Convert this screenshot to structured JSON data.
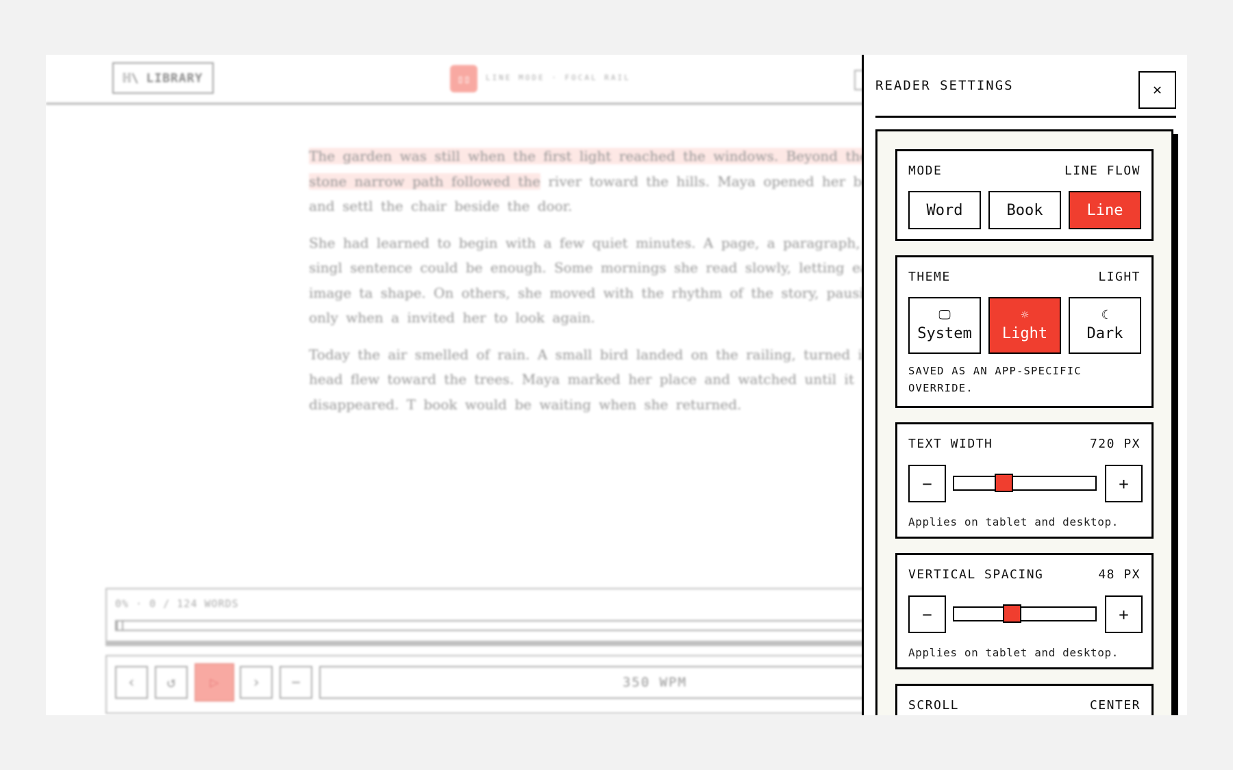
{
  "reader": {
    "library_label": "LIBRARY",
    "library_icon": "books-icon",
    "mode_icon": "book-open-icon",
    "mode_caption": "LINE MODE · FOCAL RAIL",
    "paragraphs": [
      {
        "highlight": "The garden was still when the first light reached the windows. Beyond the stone narrow path followed the",
        "rest": " river toward the hills. Maya opened her book and settl the chair beside the door."
      },
      {
        "highlight": "",
        "rest": "She had learned to begin with a few quiet minutes. A page, a paragraph, a singl sentence could be enough. Some mornings she read slowly, letting each image ta shape. On others, she moved with the rhythm of the story, pausing only when a invited her to look again."
      },
      {
        "highlight": "",
        "rest": "Today the air smelled of rain. A small bird landed on the railing, turned its head flew toward the trees. Maya marked her place and watched until it disappeared. T book would be waiting when she returned."
      }
    ],
    "progress_label": "0% · 0 / 124 WORDS",
    "progress_fraction": 0,
    "controls": {
      "prev_icon": "chevron-left-icon",
      "restart_icon": "restart-icon",
      "play_icon": "play-icon",
      "next_icon": "chevron-right-icon",
      "decrease_icon": "minus-icon",
      "wpm_label": "350 WPM"
    },
    "accent_color": "#f5766a"
  },
  "settings": {
    "title": "READER SETTINGS",
    "close_icon": "close-icon",
    "close_glyph": "✕",
    "mode": {
      "label": "MODE",
      "value": "LINE FLOW",
      "options": [
        "Word",
        "Book",
        "Line"
      ],
      "selected": "Line"
    },
    "theme": {
      "label": "THEME",
      "value": "LIGHT",
      "options": [
        {
          "label": "System",
          "icon": "monitor-icon",
          "glyph": "🖵"
        },
        {
          "label": "Light",
          "icon": "sun-icon",
          "glyph": "☼"
        },
        {
          "label": "Dark",
          "icon": "moon-icon",
          "glyph": "☾"
        }
      ],
      "selected": "Light",
      "note": "SAVED AS AN APP-SPECIFIC OVERRIDE."
    },
    "text_width": {
      "label": "TEXT WIDTH",
      "value": "720 PX",
      "minus": "−",
      "plus": "+",
      "level": 0.35,
      "note": "Applies on tablet and desktop."
    },
    "vertical_spacing": {
      "label": "VERTICAL SPACING",
      "value": "48 PX",
      "minus": "−",
      "plus": "+",
      "level": 0.41,
      "note": "Applies on tablet and desktop."
    },
    "scroll": {
      "label": "SCROLL",
      "value": "CENTER"
    },
    "accent_color": "#f03e2f"
  }
}
